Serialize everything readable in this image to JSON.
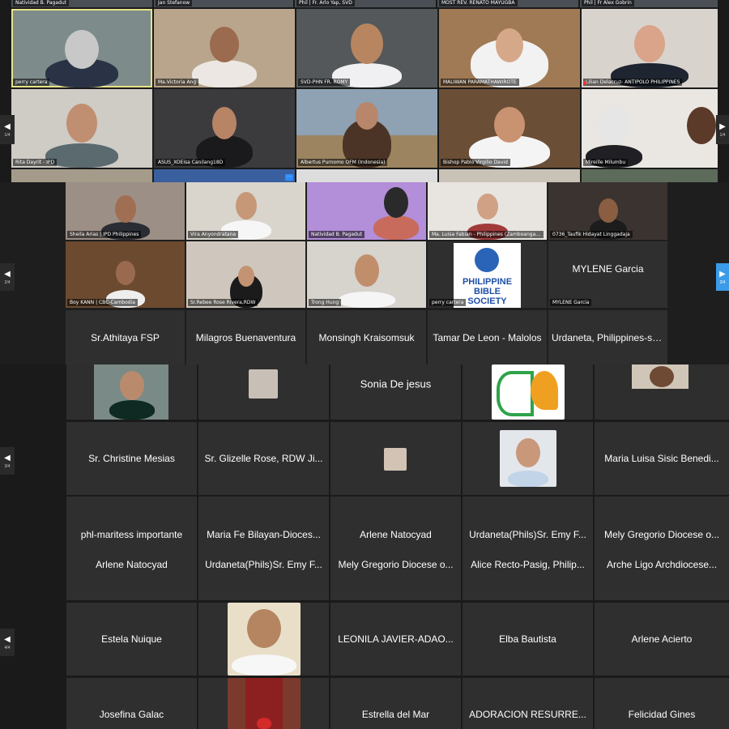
{
  "screen1": {
    "top_captions": [
      "Natividad B. Pagadut",
      "Jan Stefanow",
      "Phil | Fr. Arlo Yap, SVD",
      "MOST REV. RENATO MAYUGBA",
      "Phil | Fr Alex Gobrin"
    ],
    "row1": [
      "perry cartera",
      "Ma.Victoria Ang",
      "SVD-PHN FR. ROMY",
      "MALIWAN PARAMATHAWIROTE",
      "Lilian Delacruz- ANTIPOLO PHILIPPINES"
    ],
    "row2": [
      "Rita Dayrit - IPD",
      "ASUS_XOEisa Canilang18D",
      "Albertus Purnomo OFM (Indonesia)",
      "Bishop Pablo Virgilio David",
      "Mireille Milumbu"
    ],
    "page": "1/4"
  },
  "screen2": {
    "video_row1": [
      "Sheila Arias | IPD Philippines",
      "Vira Anyondratana",
      "Natividad B. Pagadut",
      "Ma. Luisa Fabian - Philippines (Zamboanga City)",
      "0736_Taufik Hidayat Linggadaja"
    ],
    "video_row2": [
      "Boy KANN | CBC-Cambodia",
      "Sr.Rebee Rose Rivera,RDW",
      "Trong Hung",
      "perry cartera",
      "MYLENE Garcia"
    ],
    "mylene_name": "MYLENE Garcia",
    "bible_logo": "PHILIPPINE BIBLE SOCIETY",
    "name_row": [
      "Sr.Athitaya FSP",
      "Milagros Buenaventura",
      "Monsingh Kraisomsuk",
      "Tamar De Leon - Malolos",
      "Urdaneta, Philippines-s.c..."
    ],
    "page": "2/4"
  },
  "screen3": {
    "row1_name": "Sonia De jesus",
    "row2": [
      "Sr. Christine Mesias",
      "Sr. Glizelle Rose, RDW Ji...",
      "",
      "",
      "Maria Luisa Sisic Benedi..."
    ],
    "row3": [
      "phl-maritess importante",
      "Maria Fe Bilayan-Dioces...",
      "Arlene Natocyad",
      "Urdaneta(Phils)Sr. Emy F...",
      "Mely Gregorio Diocese o..."
    ],
    "page": "3/4"
  },
  "screen4": {
    "row1": [
      "Arlene Natocyad",
      "Urdaneta(Phils)Sr. Emy F...",
      "Mely Gregorio Diocese o...",
      "Alice Recto-Pasig, Philip...",
      "Arche Ligo Archdiocese..."
    ],
    "row2": [
      "Estela Nuique",
      "",
      "LEONILA JAVIER-ADAO...",
      "Elba Bautista",
      "Arlene Acierto"
    ],
    "row3": [
      "Josefina Galac",
      "",
      "Estrella del Mar",
      "ADORACION RESURRE...",
      "Felicidad Gines"
    ],
    "page": "4/4"
  },
  "icons": {
    "prev": "chevron-left-icon",
    "next": "chevron-right-icon"
  },
  "colors": {
    "highlight": "#e8e38a",
    "accent": "#3a9be8"
  }
}
